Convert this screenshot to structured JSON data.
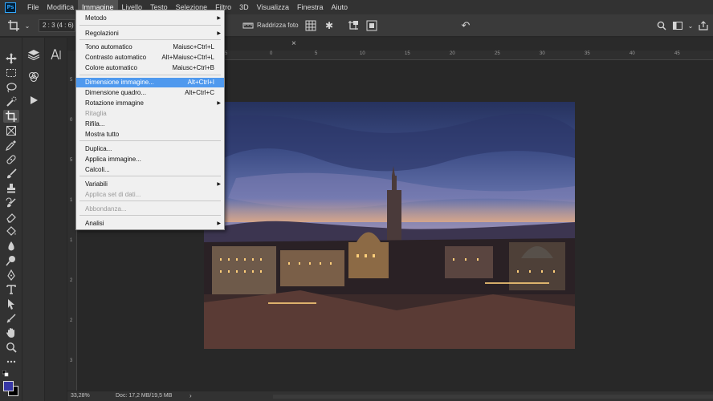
{
  "menubar": {
    "logo": "Ps",
    "items": [
      "File",
      "Modifica",
      "Immagine",
      "Livello",
      "Testo",
      "Selezione",
      "Filtro",
      "3D",
      "Visualizza",
      "Finestra",
      "Aiuto"
    ],
    "active_index": 2
  },
  "options_bar": {
    "ratio_value": "2 : 3 (4 : 6)",
    "straighten_label": "Raddrizza foto",
    "icons": [
      "crop-icon",
      "chevron-down-icon",
      "straighten-icon",
      "grid-overlay-icon",
      "gear-icon",
      "delete-crop-icon",
      "content-aware-icon",
      "reset-icon",
      "search-icon",
      "workspace-icon",
      "share-icon"
    ]
  },
  "image_menu": {
    "items": [
      {
        "label": "Metodo",
        "shortcut": "",
        "submenu": true,
        "disabled": false,
        "highlighted": false
      },
      {
        "label": "Regolazioni",
        "shortcut": "",
        "submenu": true,
        "disabled": false,
        "highlighted": false
      },
      {
        "label": "Tono automatico",
        "shortcut": "Maiusc+Ctrl+L",
        "submenu": false,
        "disabled": false,
        "highlighted": false
      },
      {
        "label": "Contrasto automatico",
        "shortcut": "Alt+Maiusc+Ctrl+L",
        "submenu": false,
        "disabled": false,
        "highlighted": false
      },
      {
        "label": "Colore automatico",
        "shortcut": "Maiusc+Ctrl+B",
        "submenu": false,
        "disabled": false,
        "highlighted": false
      },
      {
        "label": "Dimensione immagine...",
        "shortcut": "Alt+Ctrl+I",
        "submenu": false,
        "disabled": false,
        "highlighted": true
      },
      {
        "label": "Dimensione quadro...",
        "shortcut": "Alt+Ctrl+C",
        "submenu": false,
        "disabled": false,
        "highlighted": false
      },
      {
        "label": "Rotazione immagine",
        "shortcut": "",
        "submenu": true,
        "disabled": false,
        "highlighted": false
      },
      {
        "label": "Ritaglia",
        "shortcut": "",
        "submenu": false,
        "disabled": true,
        "highlighted": false
      },
      {
        "label": "Rifila...",
        "shortcut": "",
        "submenu": false,
        "disabled": false,
        "highlighted": false
      },
      {
        "label": "Mostra tutto",
        "shortcut": "",
        "submenu": false,
        "disabled": false,
        "highlighted": false
      },
      {
        "label": "Duplica...",
        "shortcut": "",
        "submenu": false,
        "disabled": false,
        "highlighted": false
      },
      {
        "label": "Applica immagine...",
        "shortcut": "",
        "submenu": false,
        "disabled": false,
        "highlighted": false
      },
      {
        "label": "Calcoli...",
        "shortcut": "",
        "submenu": false,
        "disabled": false,
        "highlighted": false
      },
      {
        "label": "Variabili",
        "shortcut": "",
        "submenu": true,
        "disabled": false,
        "highlighted": false
      },
      {
        "label": "Applica set di dati...",
        "shortcut": "",
        "submenu": false,
        "disabled": true,
        "highlighted": false
      },
      {
        "label": "Abbondanza...",
        "shortcut": "",
        "submenu": false,
        "disabled": true,
        "highlighted": false
      },
      {
        "label": "Analisi",
        "shortcut": "",
        "submenu": true,
        "disabled": false,
        "highlighted": false
      }
    ]
  },
  "tools": [
    "move-tool-icon",
    "marquee-tool-icon",
    "lasso-tool-icon",
    "quick-select-tool-icon",
    "crop-tool-icon",
    "frame-tool-icon",
    "eyedropper-tool-icon",
    "healing-brush-tool-icon",
    "brush-tool-icon",
    "clone-stamp-tool-icon",
    "history-brush-tool-icon",
    "eraser-tool-icon",
    "paint-bucket-tool-icon",
    "blur-tool-icon",
    "dodge-tool-icon",
    "pen-tool-icon",
    "type-tool-icon",
    "path-select-tool-icon",
    "shape-tool-icon",
    "hand-tool-icon",
    "zoom-tool-icon",
    "more-tools-icon"
  ],
  "panel_icons": [
    "layers-panel-icon",
    "channels-panel-icon",
    "actions-panel-icon",
    "character-panel-icon"
  ],
  "ruler": {
    "h_ticks": [
      "5",
      "0",
      "5",
      "10",
      "15",
      "20",
      "25",
      "30",
      "35",
      "40",
      "45"
    ],
    "v_ticks": [
      "5",
      "0",
      "5",
      "1",
      "1",
      "2",
      "2",
      "3"
    ]
  },
  "colors": {
    "foreground": "#3737a5",
    "background": "#000000",
    "highlight": "#4f99ee"
  },
  "status_bar": {
    "zoom": "33,28%",
    "doc_info": "Doc: 17,2 MB/19,5 MB",
    "arrow": "›"
  }
}
